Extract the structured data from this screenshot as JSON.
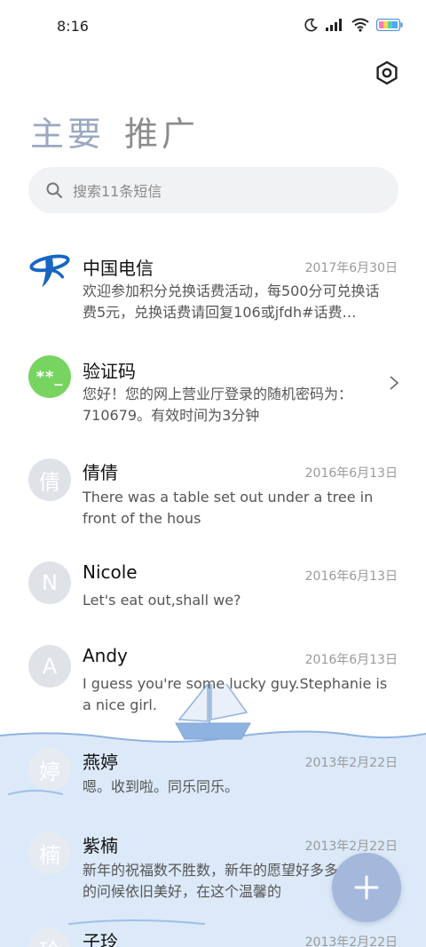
{
  "status_bar": {
    "time": "8:16",
    "battery_color": "#ffd54a"
  },
  "header": {
    "settings_icon": "gear-icon",
    "tabs": [
      {
        "label": "主要",
        "active": true
      },
      {
        "label": "推广",
        "active": false
      }
    ]
  },
  "search": {
    "placeholder": "搜索11条短信"
  },
  "conversations": [
    {
      "name": "中国电信",
      "date": "2017年6月30日",
      "preview": "欢迎参加积分兑换话费活动，每500分可兑换话费5元，兑换话费请回复106或jfdh#话费…",
      "avatar": "china-telecom-logo"
    },
    {
      "name": "验证码",
      "date": "",
      "preview": "您好！您的网上营业厅登录的随机密码为：710679。有效时间为3分钟",
      "avatar_text": "**_",
      "avatar_color": "#78d460"
    },
    {
      "name": "倩倩",
      "date": "2016年6月13日",
      "preview": "There was a table set out under a tree in front of the hous",
      "avatar_text": "倩"
    },
    {
      "name": "Nicole",
      "date": "2016年6月13日",
      "preview": "Let's eat out,shall we?",
      "avatar_text": "N"
    },
    {
      "name": "Andy",
      "date": "2016年6月13日",
      "preview": "I guess you're some lucky guy.Stephanie is a nice girl.",
      "avatar_text": "A"
    },
    {
      "name": "燕婷",
      "date": "2013年2月22日",
      "preview": "嗯。收到啦。同乐同乐。",
      "avatar_text": "婷"
    },
    {
      "name": "紫楠",
      "date": "2013年2月22日",
      "preview": "新年的祝福数不胜数，新年的愿望好多多，新年的问候依旧美好，在这个温馨的",
      "avatar_text": "楠"
    },
    {
      "name": "子玲",
      "date": "2013年2月22日",
      "preview": "",
      "avatar_text": "玲"
    }
  ],
  "fab": {
    "icon": "plus-icon",
    "color": "#a4b8dc"
  },
  "decoration": {
    "ocean_color": "#dce9f8",
    "boat": "sailboat-illustration"
  }
}
